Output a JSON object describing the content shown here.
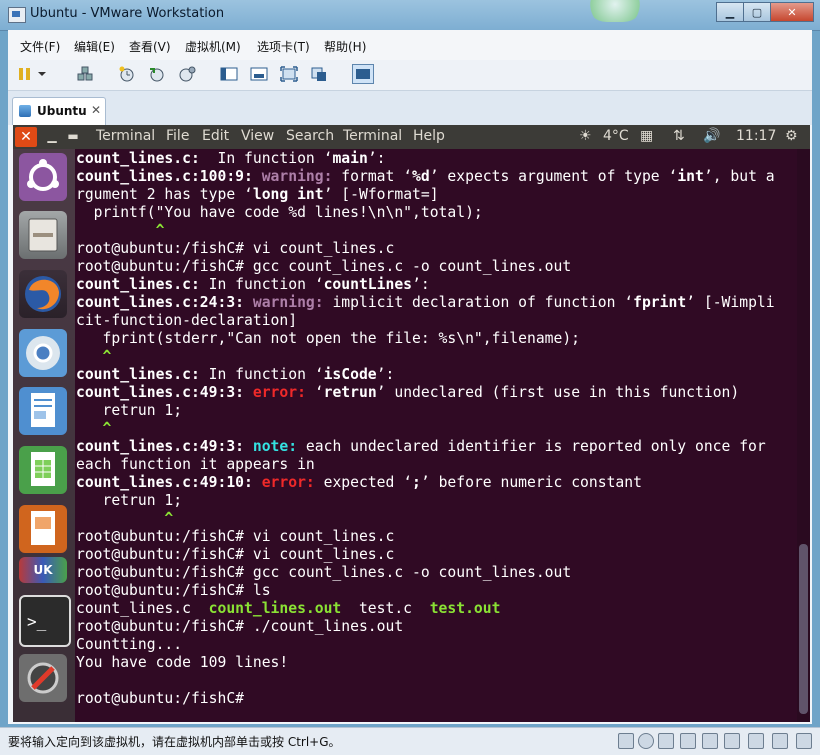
{
  "window": {
    "title": "Ubuntu - VMware Workstation",
    "min": "▁",
    "max": "▢",
    "close": "✕"
  },
  "menubar": [
    "文件(F)",
    "编辑(E)",
    "查看(V)",
    "虚拟机(M)",
    "选项卡(T)",
    "帮助(H)"
  ],
  "tab": {
    "label": "Ubuntu",
    "close": "✕"
  },
  "guest_panel": {
    "close": "✕",
    "min": "▁",
    "max": "▬",
    "menus": [
      "Terminal",
      "File",
      "Edit",
      "View",
      "Search",
      "Terminal",
      "Help"
    ],
    "weather": "4°C",
    "time": "11:17"
  },
  "terminal_lines": [
    [
      [
        "b",
        "count_lines.c:"
      ],
      [
        "",
        "  In function ‘"
      ],
      [
        "b",
        "main"
      ],
      [
        "",
        "’:"
      ]
    ],
    [
      [
        "b",
        "count_lines.c:100:9:"
      ],
      [
        "warn",
        " warning:"
      ],
      [
        "",
        " format ‘"
      ],
      [
        "b",
        "%d"
      ],
      [
        "",
        "’ expects argument of type ‘"
      ],
      [
        "b",
        "int"
      ],
      [
        "",
        "’, but a"
      ]
    ],
    [
      [
        "",
        "rgument 2 has type ‘"
      ],
      [
        "b",
        "long int"
      ],
      [
        "",
        "’ [-Wformat=]"
      ]
    ],
    [
      [
        "",
        "  printf(\"You have code %d lines!\\n\\n\",total);"
      ]
    ],
    [
      [
        "caret",
        "         ^"
      ]
    ],
    [
      [
        "",
        "root@ubuntu:/fishC# vi count_lines.c"
      ]
    ],
    [
      [
        "",
        "root@ubuntu:/fishC# gcc count_lines.c -o count_lines.out"
      ]
    ],
    [
      [
        "b",
        "count_lines.c:"
      ],
      [
        "",
        " In function ‘"
      ],
      [
        "b",
        "countLines"
      ],
      [
        "",
        "’:"
      ]
    ],
    [
      [
        "b",
        "count_lines.c:24:3:"
      ],
      [
        "warn",
        " warning:"
      ],
      [
        "",
        " implicit declaration of function ‘"
      ],
      [
        "b",
        "fprint"
      ],
      [
        "",
        "’ [-Wimpli"
      ]
    ],
    [
      [
        "",
        "cit-function-declaration]"
      ]
    ],
    [
      [
        "",
        "   fprint(stderr,\"Can not open the file: %s\\n\",filename);"
      ]
    ],
    [
      [
        "caret",
        "   ^"
      ]
    ],
    [
      [
        "b",
        "count_lines.c:"
      ],
      [
        "",
        " In function ‘"
      ],
      [
        "b",
        "isCode"
      ],
      [
        "",
        "’:"
      ]
    ],
    [
      [
        "b",
        "count_lines.c:49:3:"
      ],
      [
        "err",
        " error:"
      ],
      [
        "",
        " ‘"
      ],
      [
        "b",
        "retrun"
      ],
      [
        "",
        "’ undeclared (first use in this function)"
      ]
    ],
    [
      [
        "",
        "   retrun 1;"
      ]
    ],
    [
      [
        "caret",
        "   ^"
      ]
    ],
    [
      [
        "b",
        "count_lines.c:49:3:"
      ],
      [
        "note",
        " note:"
      ],
      [
        "",
        " each undeclared identifier is reported only once for"
      ]
    ],
    [
      [
        "",
        "each function it appears in"
      ]
    ],
    [
      [
        "b",
        "count_lines.c:49:10:"
      ],
      [
        "err",
        " error:"
      ],
      [
        "",
        " expected ‘"
      ],
      [
        "b",
        ";"
      ],
      [
        "",
        "’ before numeric constant"
      ]
    ],
    [
      [
        "",
        "   retrun 1;"
      ]
    ],
    [
      [
        "caret",
        "          ^"
      ]
    ],
    [
      [
        "",
        "root@ubuntu:/fishC# vi count_lines.c"
      ]
    ],
    [
      [
        "",
        "root@ubuntu:/fishC# vi count_lines.c"
      ]
    ],
    [
      [
        "",
        "root@ubuntu:/fishC# gcc count_lines.c -o count_lines.out"
      ]
    ],
    [
      [
        "",
        "root@ubuntu:/fishC# ls"
      ]
    ],
    [
      [
        "",
        "count_lines.c  "
      ],
      [
        "exec",
        "count_lines.out"
      ],
      [
        "",
        "  test.c  "
      ],
      [
        "exec",
        "test.out"
      ]
    ],
    [
      [
        "",
        "root@ubuntu:/fishC# ./count_lines.out"
      ]
    ],
    [
      [
        "",
        "Countting..."
      ]
    ],
    [
      [
        "",
        "You have code 109 lines!"
      ]
    ],
    [
      [
        "",
        ""
      ]
    ],
    [
      [
        "",
        "root@ubuntu:/fishC#"
      ]
    ]
  ],
  "status": {
    "message": "要将输入定向到该虚拟机，请在虚拟机内部单击或按 Ctrl+G。"
  },
  "colors": {
    "terminal_bg": "#300a24",
    "warning": "#ad7fa8",
    "error": "#ef2929",
    "note": "#34e2e2",
    "caret": "#8ae234"
  },
  "icons": [
    "pause-icon",
    "snapshot-icon",
    "revert-icon",
    "manage-snapshots-icon",
    "view-sidebar-icon",
    "console-icon",
    "fullscreen-icon",
    "unity-icon",
    "thumbnail-icon",
    "ubuntu-logo-icon",
    "files-icon",
    "firefox-icon",
    "chromium-icon",
    "writer-icon",
    "calc-icon",
    "impress-icon",
    "terminal-icon",
    "settings-icon"
  ]
}
